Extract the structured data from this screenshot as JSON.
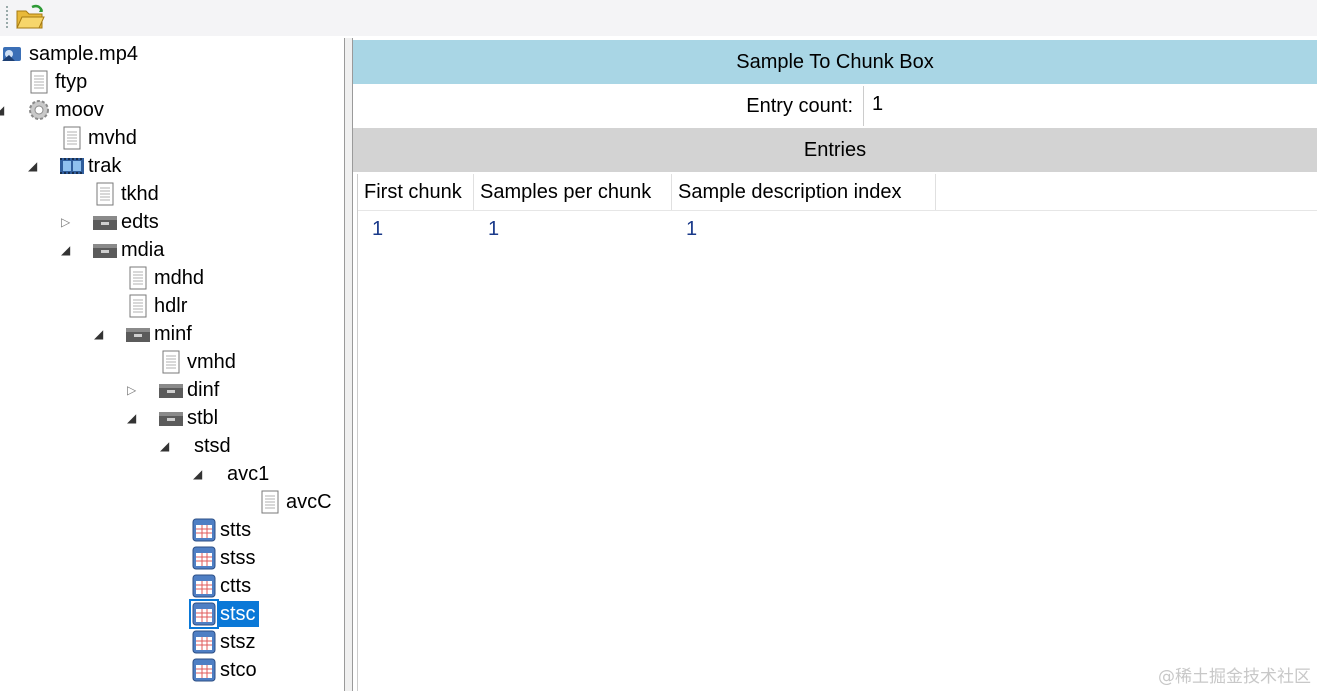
{
  "tree": {
    "nodes": [
      {
        "label": "sample.mp4",
        "icon": "file-video-icon",
        "expander": "expanded"
      },
      {
        "label": "ftyp",
        "icon": "document-icon",
        "expander": "none"
      },
      {
        "label": "moov",
        "icon": "gear-icon",
        "expander": "expanded"
      },
      {
        "label": "mvhd",
        "icon": "document-icon",
        "expander": "none"
      },
      {
        "label": "trak",
        "icon": "film-icon",
        "expander": "expanded"
      },
      {
        "label": "tkhd",
        "icon": "document-icon",
        "expander": "none"
      },
      {
        "label": "edts",
        "icon": "container-icon",
        "expander": "collapsed"
      },
      {
        "label": "mdia",
        "icon": "container-icon",
        "expander": "expanded"
      },
      {
        "label": "mdhd",
        "icon": "document-icon",
        "expander": "none"
      },
      {
        "label": "hdlr",
        "icon": "document-icon",
        "expander": "none"
      },
      {
        "label": "minf",
        "icon": "container-icon",
        "expander": "expanded"
      },
      {
        "label": "vmhd",
        "icon": "document-icon",
        "expander": "none"
      },
      {
        "label": "dinf",
        "icon": "container-icon",
        "expander": "collapsed"
      },
      {
        "label": "stbl",
        "icon": "container-icon",
        "expander": "expanded"
      },
      {
        "label": "stsd",
        "icon": "none",
        "expander": "expanded"
      },
      {
        "label": "avc1",
        "icon": "none",
        "expander": "expanded"
      },
      {
        "label": "avcC",
        "icon": "document-icon",
        "expander": "none"
      },
      {
        "label": "stts",
        "icon": "table-icon",
        "expander": "none"
      },
      {
        "label": "stss",
        "icon": "table-icon",
        "expander": "none"
      },
      {
        "label": "ctts",
        "icon": "table-icon",
        "expander": "none"
      },
      {
        "label": "stsc",
        "icon": "table-icon",
        "expander": "none",
        "selected": true
      },
      {
        "label": "stsz",
        "icon": "table-icon",
        "expander": "none"
      },
      {
        "label": "stco",
        "icon": "table-icon",
        "expander": "none"
      }
    ]
  },
  "detail": {
    "title": "Sample To Chunk Box",
    "entry_count_label": "Entry count:",
    "entry_count_value": "1",
    "entries_header": "Entries",
    "columns": [
      "First chunk",
      "Samples per chunk",
      "Sample description index"
    ],
    "rows": [
      [
        "1",
        "1",
        "1"
      ]
    ]
  },
  "watermark": "@稀土掘金技术社区",
  "colors": {
    "title_bar": "#a9d6e5",
    "section_bar": "#d3d3d3",
    "selection": "#0a78d7",
    "cell_text": "#1a3a8a"
  }
}
